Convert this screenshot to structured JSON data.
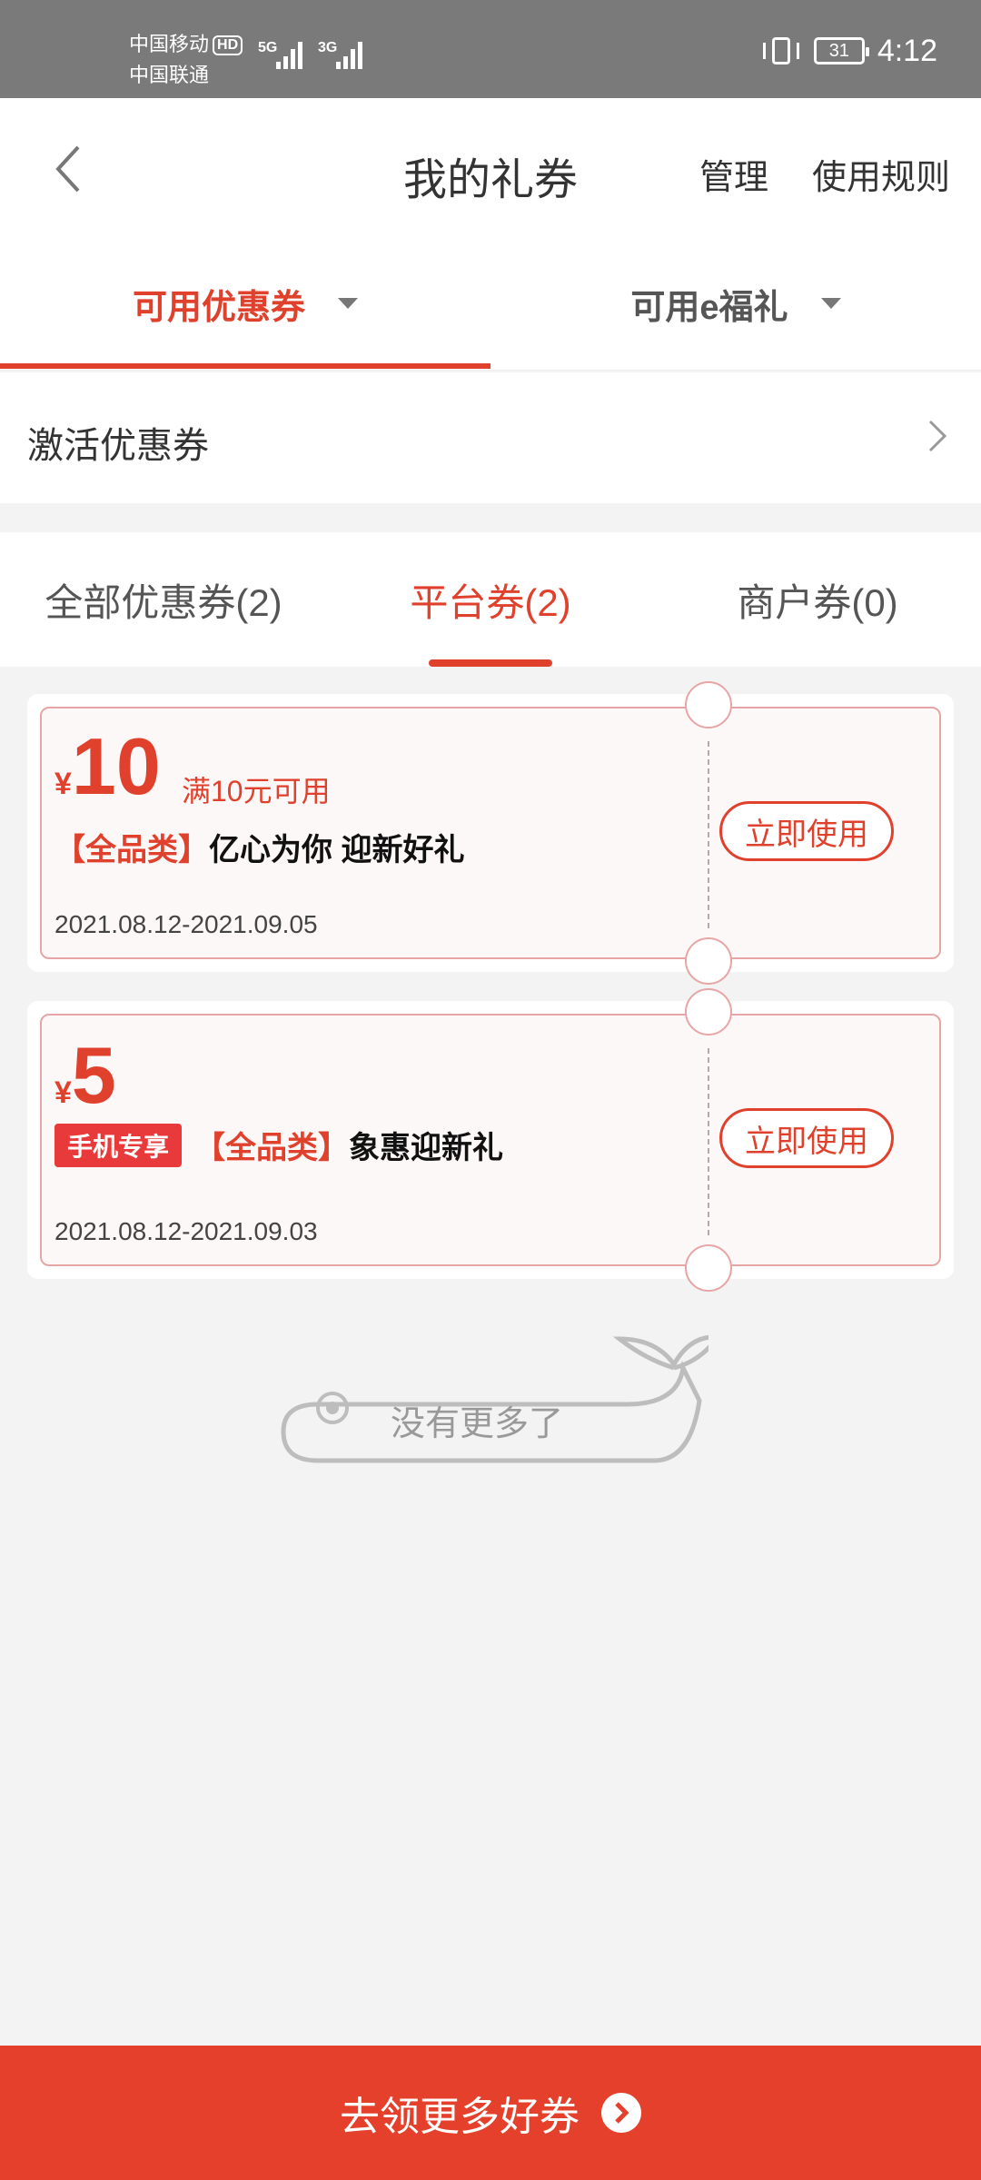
{
  "statusbar": {
    "carrier1": "中国移动",
    "hd": "HD",
    "carrier2": "中国联通",
    "net1": "5G",
    "net2": "3G",
    "battery": "31",
    "time": "4:12"
  },
  "nav": {
    "title": "我的礼券",
    "manage": "管理",
    "rules": "使用规则"
  },
  "main_tabs": [
    {
      "label": "可用优惠券",
      "active": true
    },
    {
      "label": "可用e福礼",
      "active": false
    }
  ],
  "activate": {
    "label": "激活优惠券"
  },
  "sub_tabs": [
    {
      "label": "全部优惠券(2)",
      "active": false
    },
    {
      "label": "平台券(2)",
      "active": true
    },
    {
      "label": "商户券(0)",
      "active": false
    }
  ],
  "coupons": [
    {
      "currency": "¥",
      "amount": "10",
      "condition": "满10元可用",
      "category": "【全品类】",
      "name": "亿心为你 迎新好礼",
      "date": "2021.08.12-2021.09.05",
      "button": "立即使用"
    },
    {
      "currency": "¥",
      "amount": "5",
      "badge": "手机专享",
      "category": "【全品类】",
      "name": "象惠迎新礼",
      "date": "2021.08.12-2021.09.03",
      "button": "立即使用"
    }
  ],
  "empty": {
    "text": "没有更多了"
  },
  "bottom": {
    "label": "去领更多好券"
  },
  "colors": {
    "accent": "#e0412c",
    "bottom_bar": "#e5402b"
  }
}
